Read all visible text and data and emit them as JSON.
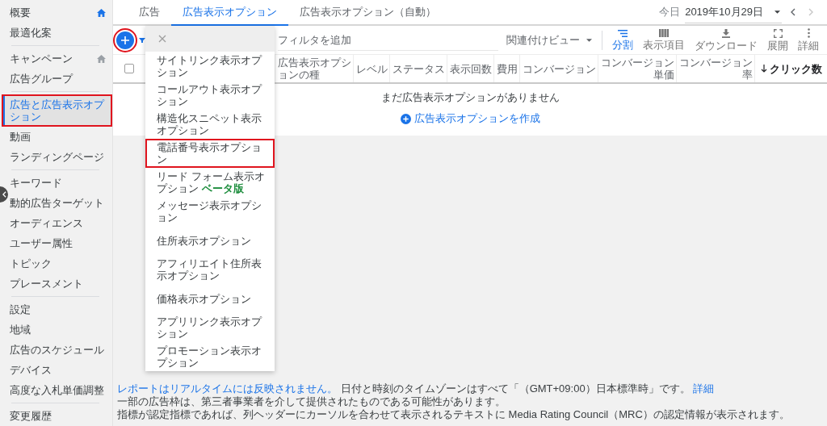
{
  "sidebar": {
    "sections": [
      {
        "items": [
          {
            "label": "概要",
            "kind": "home",
            "home_active": true,
            "selected": false,
            "annotated": false
          },
          {
            "label": "最適化案",
            "kind": "plain",
            "selected": false,
            "annotated": false
          }
        ]
      },
      {
        "items": [
          {
            "label": "キャンペーン",
            "kind": "home",
            "home_active": false,
            "selected": false,
            "annotated": false
          },
          {
            "label": "広告グループ",
            "kind": "plain",
            "selected": false,
            "annotated": false
          }
        ]
      },
      {
        "items": [
          {
            "label": "広告と広告表示オプション",
            "kind": "plain",
            "selected": true,
            "annotated": true
          },
          {
            "label": "動画",
            "kind": "plain",
            "selected": false,
            "annotated": false
          },
          {
            "label": "ランディングページ",
            "kind": "plain",
            "selected": false,
            "annotated": false
          }
        ]
      },
      {
        "items": [
          {
            "label": "キーワード",
            "kind": "plain",
            "selected": false,
            "annotated": false
          },
          {
            "label": "動的広告ターゲット",
            "kind": "plain",
            "selected": false,
            "annotated": false
          },
          {
            "label": "オーディエンス",
            "kind": "plain",
            "selected": false,
            "annotated": false
          },
          {
            "label": "ユーザー属性",
            "kind": "plain",
            "selected": false,
            "annotated": false
          },
          {
            "label": "トピック",
            "kind": "plain",
            "selected": false,
            "annotated": false
          },
          {
            "label": "プレースメント",
            "kind": "plain",
            "selected": false,
            "annotated": false
          }
        ]
      },
      {
        "items": [
          {
            "label": "設定",
            "kind": "plain",
            "selected": false,
            "annotated": false
          },
          {
            "label": "地域",
            "kind": "plain",
            "selected": false,
            "annotated": false
          },
          {
            "label": "広告のスケジュール",
            "kind": "plain",
            "selected": false,
            "annotated": false
          },
          {
            "label": "デバイス",
            "kind": "plain",
            "selected": false,
            "annotated": false
          },
          {
            "label": "高度な入札単価調整",
            "kind": "plain",
            "selected": false,
            "annotated": false
          }
        ]
      },
      {
        "items": [
          {
            "label": "変更履歴",
            "kind": "plain",
            "selected": false,
            "annotated": false
          }
        ]
      }
    ]
  },
  "tabs": [
    {
      "label": "広告",
      "selected": false
    },
    {
      "label": "広告表示オプション",
      "selected": true
    },
    {
      "label": "広告表示オプション（自動）",
      "selected": false
    }
  ],
  "date_range": {
    "label": "今日",
    "value": "2019年10月29日",
    "nav": [
      {
        "kind": "prev",
        "disabled": false
      },
      {
        "kind": "next",
        "disabled": true
      }
    ]
  },
  "toolbar": {
    "add_button": {
      "annotated": true
    },
    "filter": {
      "placeholder": "フィルタを追加"
    },
    "view_menu": {
      "label": "関連付けビュー"
    },
    "tools": [
      {
        "kind": "split",
        "label": "分割",
        "selected": true
      },
      {
        "kind": "columns",
        "label": "表示項目",
        "selected": false
      },
      {
        "kind": "download",
        "label": "ダウンロード",
        "selected": false
      },
      {
        "kind": "expand",
        "label": "展開",
        "selected": false
      },
      {
        "kind": "more",
        "label": "詳細",
        "selected": false
      }
    ]
  },
  "add_menu": {
    "items": [
      {
        "label": "サイトリンク表示オプション",
        "annotated": false
      },
      {
        "label": "コールアウト表示オプション",
        "annotated": false
      },
      {
        "label": "構造化スニペット表示オプション",
        "annotated": false
      },
      {
        "label": "電話番号表示オプション",
        "annotated": true
      },
      {
        "label": "リード フォーム表示オプション",
        "badge": "ベータ版",
        "annotated": false
      },
      {
        "label": "メッセージ表示オプション",
        "annotated": false
      },
      {
        "label": "住所表示オプション",
        "annotated": false
      },
      {
        "label": "アフィリエイト住所表示オプション",
        "annotated": false
      },
      {
        "label": "価格表示オプション",
        "annotated": false
      },
      {
        "label": "アプリリンク表示オプション",
        "annotated": false
      },
      {
        "label": "プロモーション表示オプション",
        "annotated": false
      }
    ]
  },
  "table": {
    "select_all": {
      "checked": false
    },
    "columns": [
      {
        "label": "広告表示オプションの種",
        "kind": "text",
        "sorted": false
      },
      {
        "label": "レベル",
        "kind": "text",
        "sorted": false
      },
      {
        "label": "ステータス",
        "kind": "text",
        "sorted": false
      },
      {
        "label": "表示回数",
        "kind": "metric",
        "sorted": false
      },
      {
        "label": "費用",
        "kind": "metric",
        "sorted": false
      },
      {
        "label": "コンバージョン",
        "kind": "metric",
        "sorted": false
      },
      {
        "label": "コンバージョン単価",
        "kind": "metric",
        "sorted": false
      },
      {
        "label": "コンバージョン率",
        "kind": "metric",
        "sorted": false
      },
      {
        "label": "クリック数",
        "kind": "metric",
        "sorted": true
      }
    ],
    "empty_message": "まだ広告表示オプションがありません",
    "create_link": "広告表示オプションを作成"
  },
  "footer": {
    "notice_link": "レポートはリアルタイムには反映されません。",
    "timezone_text": "日付と時刻のタイムゾーンはすべて「（GMT+09:00）日本標準時」です。",
    "details_link": "詳細",
    "lines": [
      "一部の広告枠は、第三者事業者を介して提供されたものである可能性があります。",
      "指標が認定指標であれば、列ヘッダーにカーソルを合わせて表示されるテキストに Media Rating Council（MRC）の認定情報が表示されます。"
    ]
  }
}
